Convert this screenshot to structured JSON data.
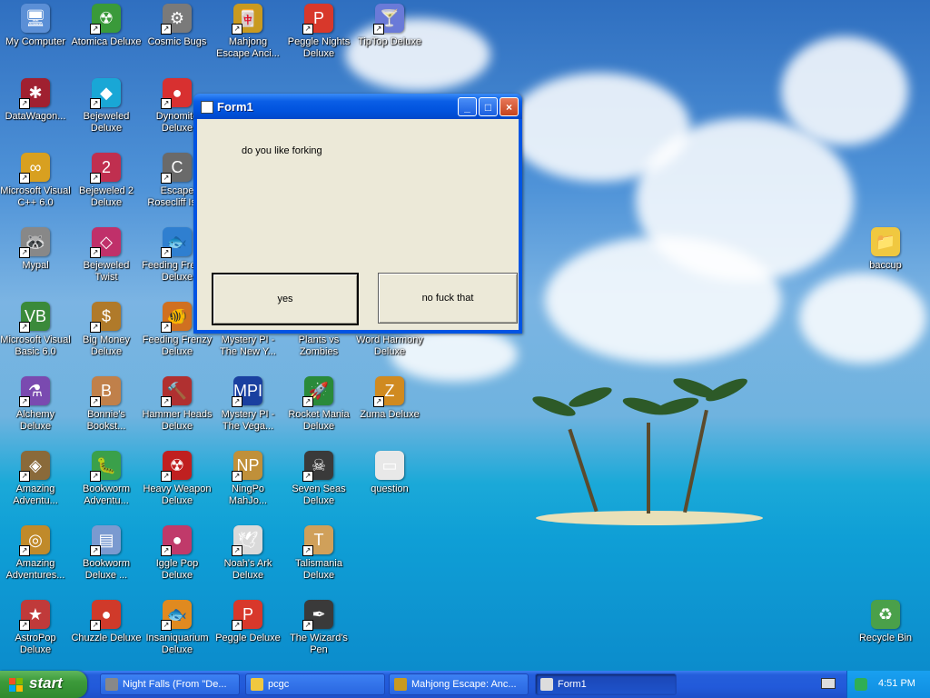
{
  "desktop": {
    "icons": [
      {
        "label": "My Computer",
        "color": "#5b8fd6",
        "glyph": "🖥"
      },
      {
        "label": "Atomica Deluxe",
        "color": "#3a9a3a",
        "glyph": "☢"
      },
      {
        "label": "Cosmic Bugs",
        "color": "#7a7a7a",
        "glyph": "⚙"
      },
      {
        "label": "Mahjong Escape Anci...",
        "color": "#c99a20",
        "glyph": "🀄"
      },
      {
        "label": "Peggle Nights Deluxe",
        "color": "#d8382b",
        "glyph": "P"
      },
      {
        "label": "TipTop Deluxe",
        "color": "#6a7ad8",
        "glyph": "🍸"
      },
      {
        "label": "DataWagon...",
        "color": "#a02030",
        "glyph": "✱"
      },
      {
        "label": "Bejeweled Deluxe",
        "color": "#19a7d6",
        "glyph": "◆"
      },
      {
        "label": "Dynomite Deluxe",
        "color": "#d83030",
        "glyph": "●"
      },
      {
        "label": "Microsoft Visual C++ 6.0",
        "color": "#d8a020",
        "glyph": "∞"
      },
      {
        "label": "Bejeweled 2 Deluxe",
        "color": "#c02f4f",
        "glyph": "2"
      },
      {
        "label": "Escape Rosecliff Isl...",
        "color": "#6a6a6a",
        "glyph": "C"
      },
      {
        "label": "Mypal",
        "color": "#888888",
        "glyph": "🦝"
      },
      {
        "label": "Bejeweled Twist",
        "color": "#c0306a",
        "glyph": "◇"
      },
      {
        "label": "Feeding Fre... 2 Deluxe",
        "color": "#2f7fd0",
        "glyph": "🐟"
      },
      {
        "label": "Microsoft Visual Basic 6.0",
        "color": "#3a8a3a",
        "glyph": "VB"
      },
      {
        "label": "Big Money Deluxe",
        "color": "#b07a2a",
        "glyph": "$"
      },
      {
        "label": "Feeding Frenzy Deluxe",
        "color": "#d07020",
        "glyph": "🐠"
      },
      {
        "label": "Mystery PI - The New Y...",
        "color": "#5a3a9a",
        "glyph": "?"
      },
      {
        "label": "Plants vs Zombies",
        "color": "#4a9a2a",
        "glyph": "🌱"
      },
      {
        "label": "Word Harmony Deluxe",
        "color": "#2a6ad0",
        "glyph": "W"
      },
      {
        "label": "Alchemy Deluxe",
        "color": "#7a4ab0",
        "glyph": "⚗"
      },
      {
        "label": "Bonnie's Bookst...",
        "color": "#c0804a",
        "glyph": "B"
      },
      {
        "label": "Hammer Heads Deluxe",
        "color": "#b03030",
        "glyph": "🔨"
      },
      {
        "label": "Mystery PI - The Vega...",
        "color": "#1a40a0",
        "glyph": "MPI"
      },
      {
        "label": "Rocket Mania Deluxe",
        "color": "#2a8a3a",
        "glyph": "🚀"
      },
      {
        "label": "Zuma Deluxe",
        "color": "#d08a20",
        "glyph": "Z"
      },
      {
        "label": "Amazing Adventu...",
        "color": "#8a6a3a",
        "glyph": "◈"
      },
      {
        "label": "Bookworm Adventu...",
        "color": "#3aa04a",
        "glyph": "🐛"
      },
      {
        "label": "Heavy Weapon Deluxe",
        "color": "#c02020",
        "glyph": "☢"
      },
      {
        "label": "NingPo MahJo...",
        "color": "#c0903a",
        "glyph": "NP"
      },
      {
        "label": "Seven Seas Deluxe",
        "color": "#3a3a3a",
        "glyph": "☠"
      },
      {
        "label": "question",
        "color": "#e8e8e8",
        "glyph": "▭"
      },
      {
        "label": "Amazing Adventures...",
        "color": "#c08a2a",
        "glyph": "◎"
      },
      {
        "label": "Bookworm Deluxe ...",
        "color": "#7a9ad0",
        "glyph": "▤"
      },
      {
        "label": "Iggle Pop Deluxe",
        "color": "#c03a6a",
        "glyph": "●"
      },
      {
        "label": "Noah's Ark Deluxe",
        "color": "#dadada",
        "glyph": "🕊"
      },
      {
        "label": "Talismania Deluxe",
        "color": "#d0a05a",
        "glyph": "T"
      },
      {
        "label": "AstroPop Deluxe",
        "color": "#c03a3a",
        "glyph": "★"
      },
      {
        "label": "Chuzzle Deluxe",
        "color": "#d03a2a",
        "glyph": "●"
      },
      {
        "label": "Insaniquarium Deluxe",
        "color": "#e08a20",
        "glyph": "🐟"
      },
      {
        "label": "Peggle Deluxe",
        "color": "#d8382b",
        "glyph": "P"
      },
      {
        "label": "The Wizard's Pen",
        "color": "#3a3a3a",
        "glyph": "✒"
      },
      {
        "label": "baccup",
        "color": "#f0c840",
        "glyph": "📁"
      },
      {
        "label": "Recycle Bin",
        "color": "#4aa04a",
        "glyph": "♻"
      }
    ]
  },
  "window": {
    "title": "Form1",
    "message": "do you like forking",
    "yes_label": "yes",
    "no_label": "no fuck that",
    "minimize_glyph": "_",
    "maximize_glyph": "□",
    "close_glyph": "×"
  },
  "taskbar": {
    "start_label": "start",
    "tasks": [
      {
        "label": "Night Falls (From \"De...",
        "icon": "#888888"
      },
      {
        "label": "pcgc",
        "icon": "#f0c840"
      },
      {
        "label": "Mahjong Escape: Anc...",
        "icon": "#c99a20"
      },
      {
        "label": "Form1",
        "icon": "#dddddd"
      }
    ],
    "clock": "4:51 PM"
  }
}
